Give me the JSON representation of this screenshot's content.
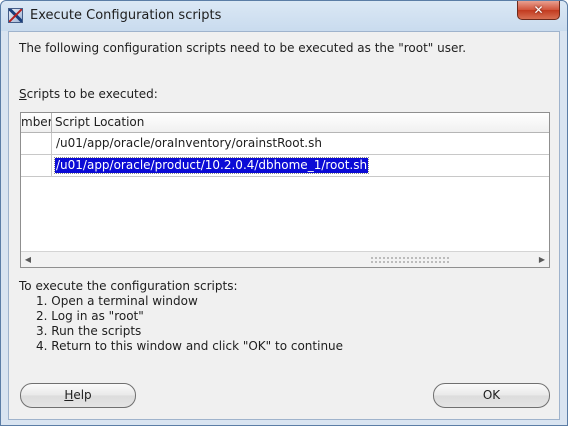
{
  "window": {
    "title": "Execute Configuration scripts",
    "close_glyph": "✕",
    "icon": "oracle-installer-icon"
  },
  "intro_text": "The following configuration scripts need to be executed as the \"root\" user.",
  "scripts_label": {
    "mnemonic": "S",
    "rest": "cripts to be executed:"
  },
  "table": {
    "columns": [
      "mber",
      "Script Location"
    ],
    "rows": [
      {
        "location": "/u01/app/oracle/oraInventory/orainstRoot.sh",
        "selected": false
      },
      {
        "location": "/u01/app/oracle/product/10.2.0.4/dbhome_1/root.sh",
        "selected": true
      }
    ],
    "scroll_left_glyph": "◀",
    "scroll_right_glyph": "▶"
  },
  "instructions": {
    "heading": "To execute the configuration scripts:",
    "steps": [
      "1. Open a terminal window",
      "2. Log in as \"root\"",
      "3. Run the scripts",
      "4. Return to this window and click \"OK\" to continue"
    ]
  },
  "buttons": {
    "help": {
      "mnemonic": "H",
      "rest": "elp"
    },
    "ok": "OK"
  },
  "colors": {
    "selection": "#0b0bd6",
    "dialog_background": "#f0f0f0",
    "frame": "#d9e4f1"
  }
}
